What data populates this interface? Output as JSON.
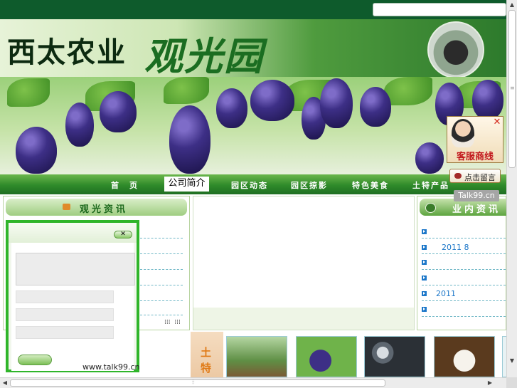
{
  "site": {
    "logo_text": "西太农业",
    "slogan": "观光园"
  },
  "nav": {
    "items": [
      "首　页",
      "公司简介",
      "园区动态",
      "园区掠影",
      "特色美食",
      "土特产品"
    ],
    "active_index": 1
  },
  "left_panel": {
    "title": "观光资讯"
  },
  "right_panel": {
    "title": "业内资讯",
    "items": [
      "",
      "2011 8",
      "",
      "",
      "2011",
      ""
    ]
  },
  "bottom": {
    "section_label_chars": [
      "土",
      "特"
    ]
  },
  "chat_popup": {
    "close_label": "✕",
    "watermark": "www.talk99.cn"
  },
  "service_widget": {
    "title": "客服商线",
    "leave_message": "点击留言",
    "brand": "Talk99.cn",
    "close_label": "✕"
  },
  "colors": {
    "accent_green": "#2f8a2a",
    "link_blue": "#1c77c9",
    "brand_red": "#c1141a"
  }
}
